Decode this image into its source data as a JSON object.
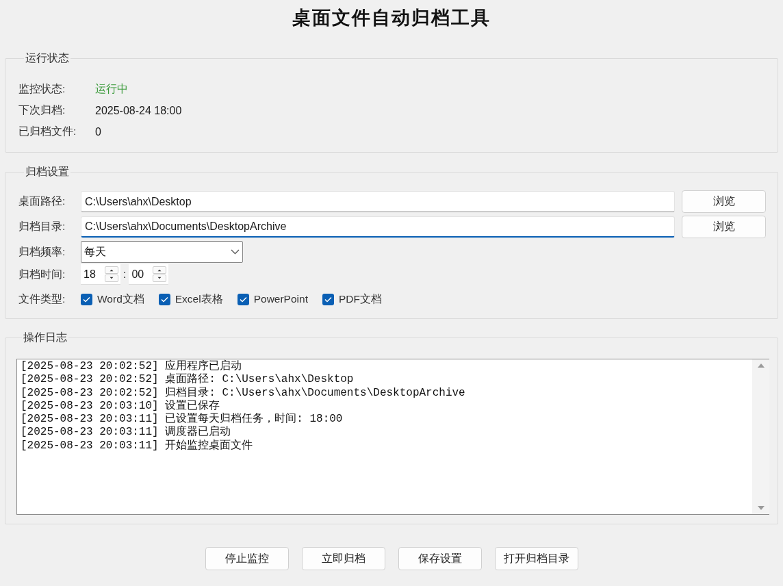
{
  "window": {
    "title": "桌面文件自动归档工具"
  },
  "status_group": {
    "legend": "运行状态",
    "rows": [
      {
        "label": "监控状态:",
        "value": "运行中",
        "kind": "state",
        "running": true
      },
      {
        "label": "下次归档:",
        "value": "2025-08-24 18:00",
        "kind": "text"
      },
      {
        "label": "已归档文件:",
        "value": "0",
        "kind": "text"
      }
    ]
  },
  "settings_group": {
    "legend": "归档设置",
    "paths": [
      {
        "label": "桌面路径:",
        "value": "C:\\Users\\ahx\\Desktop",
        "focused": false,
        "button": "浏览"
      },
      {
        "label": "归档目录:",
        "value": "C:\\Users\\ahx\\Documents\\DesktopArchive",
        "focused": true,
        "button": "浏览"
      }
    ],
    "frequency": {
      "label": "归档频率:",
      "value": "每天"
    },
    "time": {
      "label": "归档时间:",
      "hour": "18",
      "separator": ":",
      "minute": "00"
    },
    "file_types": {
      "label": "文件类型:",
      "options": [
        {
          "label": "Word文档",
          "checked": true
        },
        {
          "label": "Excel表格",
          "checked": true
        },
        {
          "label": "PowerPoint",
          "checked": true
        },
        {
          "label": "PDF文档",
          "checked": true
        }
      ]
    }
  },
  "log_group": {
    "legend": "操作日志",
    "lines": [
      "[2025-08-23 20:02:52] 应用程序已启动",
      "[2025-08-23 20:02:52] 桌面路径: C:\\Users\\ahx\\Desktop",
      "[2025-08-23 20:02:52] 归档目录: C:\\Users\\ahx\\Documents\\DesktopArchive",
      "[2025-08-23 20:03:10] 设置已保存",
      "[2025-08-23 20:03:11] 已设置每天归档任务，时间: 18:00",
      "[2025-08-23 20:03:11] 调度器已启动",
      "[2025-08-23 20:03:11] 开始监控桌面文件"
    ]
  },
  "buttons": [
    "停止监控",
    "立即归档",
    "保存设置",
    "打开归档目录"
  ]
}
